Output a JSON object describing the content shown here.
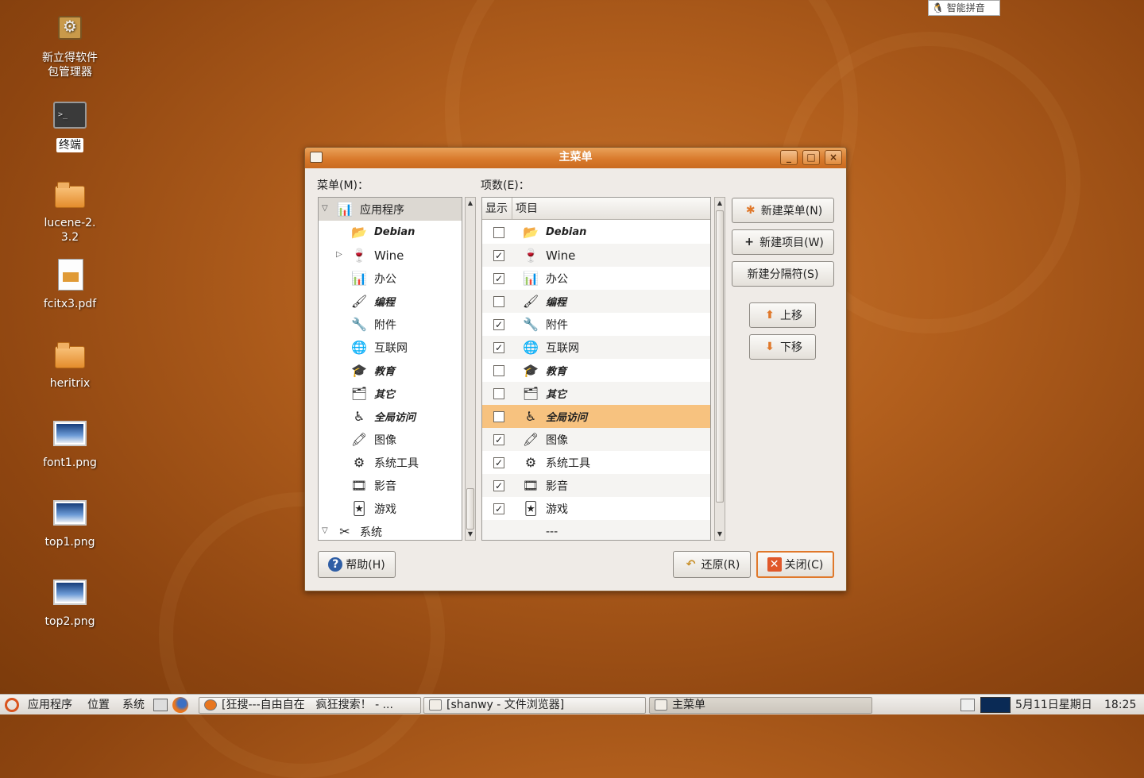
{
  "colors": {
    "accent": "#e0782a",
    "selection": "#f7c27f",
    "titlebar": "#d97a2c"
  },
  "ime": {
    "label": "智能拼音"
  },
  "desktop": {
    "icons": [
      {
        "label": "新立得软件\n包管理器",
        "icon": "package-manager-icon"
      },
      {
        "label": "终端",
        "icon": "terminal-icon"
      },
      {
        "label": "lucene-2.\n3.2",
        "icon": "folder-icon"
      },
      {
        "label": "fcitx3.pdf",
        "icon": "pdf-file-icon"
      },
      {
        "label": "heritrix",
        "icon": "folder-icon"
      },
      {
        "label": "font1.png",
        "icon": "image-file-icon"
      },
      {
        "label": "top1.png",
        "icon": "image-file-icon"
      },
      {
        "label": "top2.png",
        "icon": "image-file-icon"
      }
    ]
  },
  "dialog": {
    "title": "主菜单",
    "menu_label": "菜单(M)：",
    "items_label": "项数(E)：",
    "tree": {
      "root": "应用程序",
      "children": [
        "Debian",
        "Wine",
        "办公",
        "编程",
        "附件",
        "互联网",
        "教育",
        "其它",
        "全局访问",
        "图像",
        "系统工具",
        "影音",
        "游戏"
      ],
      "next_root": "系统"
    },
    "items_header": {
      "show": "显示",
      "item": "项目"
    },
    "items": [
      {
        "label": "Debian",
        "checked": false
      },
      {
        "label": "Wine",
        "checked": true
      },
      {
        "label": "办公",
        "checked": true
      },
      {
        "label": "编程",
        "checked": false
      },
      {
        "label": "附件",
        "checked": true
      },
      {
        "label": "互联网",
        "checked": true
      },
      {
        "label": "教育",
        "checked": false
      },
      {
        "label": "其它",
        "checked": false
      },
      {
        "label": "全局访问",
        "checked": false,
        "selected": true
      },
      {
        "label": "图像",
        "checked": true
      },
      {
        "label": "系统工具",
        "checked": true
      },
      {
        "label": "影音",
        "checked": true
      },
      {
        "label": "游戏",
        "checked": true
      },
      {
        "label": "---",
        "checked": null
      }
    ],
    "buttons": {
      "new_menu": "新建菜单(N)",
      "new_item": "新建项目(W)",
      "new_separator": "新建分隔符(S)",
      "move_up": "上移",
      "move_down": "下移",
      "help": "帮助(H)",
      "revert": "还原(R)",
      "close": "关闭(C)"
    }
  },
  "taskbar": {
    "menus": [
      "应用程序",
      "位置",
      "系统"
    ],
    "windows": [
      {
        "title": "[狂搜---自由自在　疯狂搜索！ - ...",
        "active": false
      },
      {
        "title": "[shanwy - 文件浏览器]",
        "active": false
      },
      {
        "title": "主菜单",
        "active": true
      }
    ],
    "clock": {
      "date": "5月11日星期日",
      "time": "18:25"
    }
  }
}
